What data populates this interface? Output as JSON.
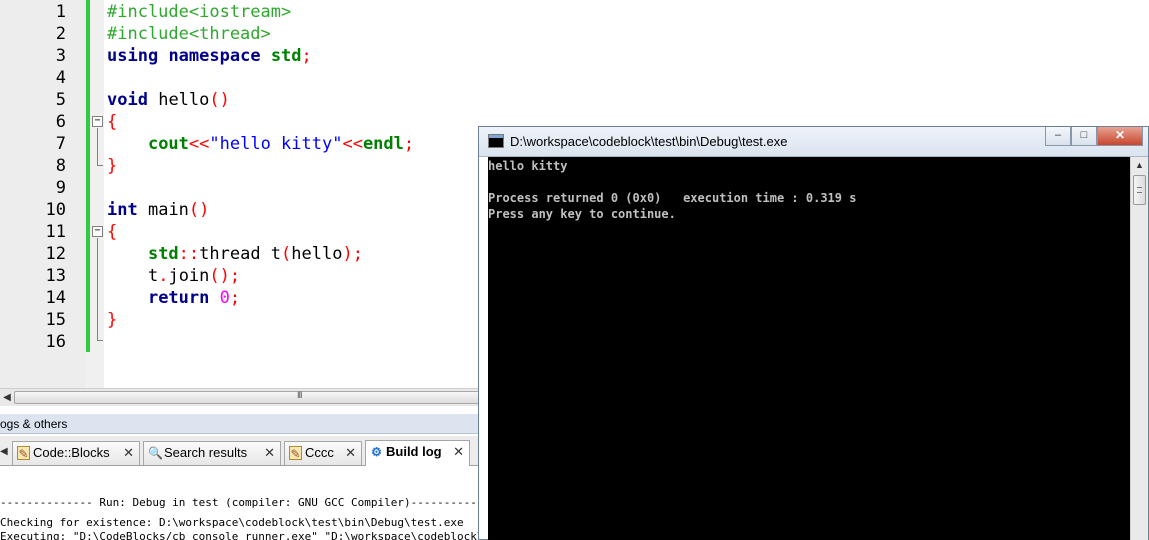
{
  "editor": {
    "lines": [
      {
        "num": "1"
      },
      {
        "num": "2"
      },
      {
        "num": "3"
      },
      {
        "num": "4"
      },
      {
        "num": "5"
      },
      {
        "num": "6"
      },
      {
        "num": "7"
      },
      {
        "num": "8"
      },
      {
        "num": "9"
      },
      {
        "num": "10"
      },
      {
        "num": "11"
      },
      {
        "num": "12"
      },
      {
        "num": "13"
      },
      {
        "num": "14"
      },
      {
        "num": "15"
      },
      {
        "num": "16"
      }
    ],
    "tokens": {
      "l1": "#include<iostream>",
      "l2": "#include<thread>",
      "l3_kw1": "using",
      "l3_kw2": "namespace",
      "l3_std": "std",
      "l3_semi": ";",
      "l5_kw": "void",
      "l5_id": "hello",
      "l5_paren": "()",
      "l6": "{",
      "l7_cout": "cout",
      "l7_op1": "<<",
      "l7_str": "\"hello kitty\"",
      "l7_op2": "<<",
      "l7_endl": "endl",
      "l7_semi": ";",
      "l8": "}",
      "l10_kw": "int",
      "l10_id": "main",
      "l10_paren": "()",
      "l11": "{",
      "l12_std": "std",
      "l12_colons": "::",
      "l12_id": "thread t",
      "l12_open": "(",
      "l12_arg": "hello",
      "l12_close": ");",
      "l13_t": "t",
      "l13_dot": ".",
      "l13_join": "join",
      "l13_call": "();",
      "l14_kw": "return",
      "l14_num": "0",
      "l14_semi": ";",
      "l15": "}"
    },
    "scroll_grip": "III"
  },
  "logs": {
    "title": "ogs & others",
    "tabs": [
      {
        "label": "Code::Blocks",
        "close": "✕"
      },
      {
        "label": "Search results",
        "close": "✕"
      },
      {
        "label": "Cccc",
        "close": "✕"
      },
      {
        "label": "Build log",
        "close": "✕"
      }
    ],
    "lines": [
      "-------------- Run: Debug in test (compiler: GNU GCC Compiler)---------------",
      "Checking for existence: D:\\workspace\\codeblock\\test\\bin\\Debug\\test.exe",
      "Executing: \"D:\\CodeBlocks/cb_console_runner.exe\" \"D:\\workspace\\codeblock\\test\\bin\\Debug\\test.exe\""
    ]
  },
  "console": {
    "title": "D:\\workspace\\codeblock\\test\\bin\\Debug\\test.exe",
    "output": [
      "hello kitty",
      "",
      "Process returned 0 (0x0)   execution time : 0.319 s",
      "Press any key to continue."
    ],
    "buttons": {
      "minimize": "–",
      "maximize": "□",
      "close": "✕"
    }
  },
  "colors": {
    "preprocessor": "#2ea82e",
    "keyword": "#00008b",
    "operator": "#ff0000",
    "string": "#0000ff",
    "number": "#ff00ff",
    "changebar": "#2ecc40"
  }
}
